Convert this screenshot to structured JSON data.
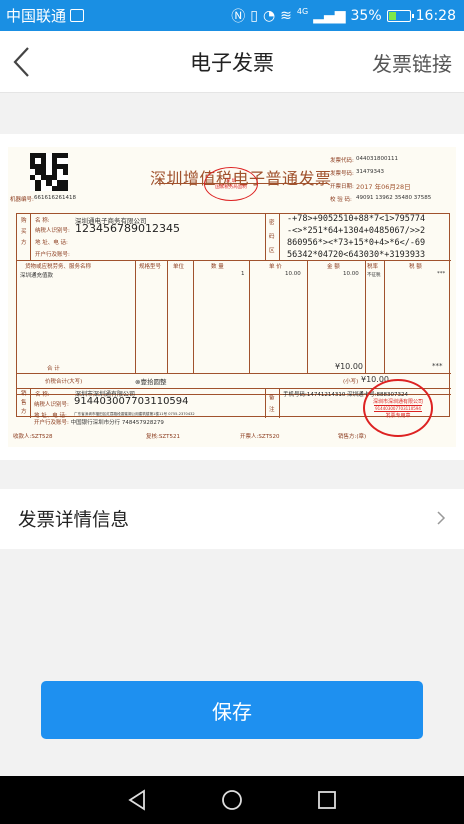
{
  "status_bar": {
    "carrier": "中国联通",
    "battery_percent": "35%",
    "time": "16:28",
    "network": "4G"
  },
  "nav": {
    "title": "电子发票",
    "right_link": "发票链接"
  },
  "invoice": {
    "title": "深圳增值税电子普通发票",
    "machine_no_label": "机器编号:",
    "machine_no": "661616261418",
    "code_label": "发票代码:",
    "code": "044031800111",
    "number_label": "发票号码:",
    "number": "31479343",
    "date_label": "开票日期:",
    "date": "2017 年06月28日",
    "check_label": "校 验 码:",
    "check_code": "49091 13962 35480 37585",
    "title_seal": {
      "line1": "深 圳",
      "line2": "国家税务局监制"
    },
    "buyer": {
      "section": "购买方",
      "name_label": "名    称:",
      "name": "深圳通电子商务有限公司",
      "tax_label": "纳税人识别号:",
      "tax_id": "123456789012345",
      "addr_label": "地 址、电 话:",
      "bank_label": "开户行及账号:"
    },
    "cipher": {
      "section": "密码区",
      "lines": [
        "-+78>+9052510+88*7<1>795774",
        "-<>*251*64+1304+0485067/>>2",
        "860956*><*73+15*0+4>*6</-69",
        "56342*04720<643030*+3193933"
      ]
    },
    "items": {
      "headers": [
        "货物或应税劳务、服务名称",
        "规格型号",
        "单位",
        "数 量",
        "单 价",
        "金 额",
        "税率",
        "税 额"
      ],
      "row": {
        "name": "深圳通充值款",
        "qty": "1",
        "price": "10.00",
        "amount": "10.00",
        "rate": "不征税",
        "tax": "***"
      },
      "total_label": "合          计",
      "total_amount": "¥10.00",
      "total_tax": "***"
    },
    "grand": {
      "label": "价税合计(大写)",
      "words": "⊗壹拾圆整",
      "small_label": "(小写)",
      "small": "¥10.00"
    },
    "seller": {
      "section": "销售方",
      "name_label": "名    称:",
      "name": "深圳市深圳通有限公司",
      "tax_label": "纳税人识别号:",
      "tax_id": "914403007703110594",
      "addr_label": "地 址、电 话:",
      "addr": "广东省深圳市福田区红荔路段香蜜湖公用建筑楼第1楼11号 0755-2370432",
      "bank_label": "开户行及账号:",
      "bank": "中国银行深圳市分行 748457928279"
    },
    "remarks": {
      "section": "备注",
      "text": "手机号码:14741214310 深圳通卡号:888307324"
    },
    "seller_seal": {
      "ring": "深圳市深圳通有限公司",
      "number": "914403007703110594",
      "label": "发票专用章"
    },
    "footer": {
      "payee": "收款人:SZT528",
      "reviewer": "复核:SZT521",
      "issuer": "开票人:SZT520",
      "seller": "销售方:(章)"
    }
  },
  "detail": {
    "label": "发票详情信息"
  },
  "save_label": "保存",
  "colors": {
    "status_bar": "#1a8fe3",
    "save_button": "#1e90f0",
    "invoice_ink": "#8a3a1c",
    "seal": "#dd2222"
  }
}
